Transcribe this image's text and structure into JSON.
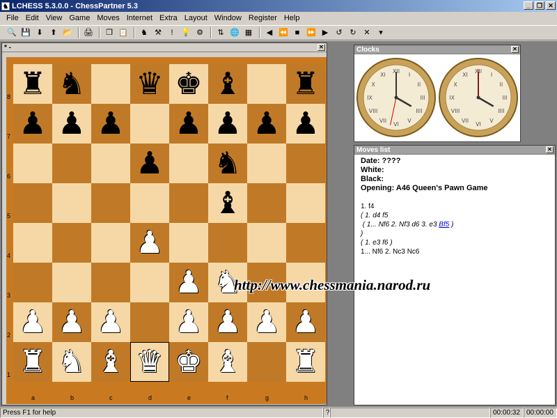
{
  "window": {
    "title": "LCHESS 5.3.0.0 - ChessPartner 5.3",
    "btn_min": "_",
    "btn_restore": "❐",
    "btn_close": "✕"
  },
  "menu": [
    "File",
    "Edit",
    "View",
    "Game",
    "Moves",
    "Internet",
    "Extra",
    "Layout",
    "Window",
    "Register",
    "Help"
  ],
  "toolbar": {
    "groups": [
      [
        {
          "icon": "search-icon",
          "glyph": "🔍"
        },
        {
          "icon": "save-icon",
          "glyph": "💾"
        },
        {
          "icon": "arrow-down-icon",
          "glyph": "⬇"
        },
        {
          "icon": "arrow-up-icon",
          "glyph": "⬆"
        },
        {
          "icon": "open-folder-icon",
          "glyph": "📂"
        }
      ],
      [
        {
          "icon": "print-icon",
          "glyph": "🖨"
        }
      ],
      [
        {
          "icon": "copy-icon",
          "glyph": "❐"
        },
        {
          "icon": "paste-icon",
          "glyph": "📋"
        }
      ],
      [
        {
          "icon": "board-setup-icon",
          "glyph": "♞"
        },
        {
          "icon": "analysis-icon",
          "glyph": "⚒"
        },
        {
          "icon": "exclaim-icon",
          "glyph": "!"
        },
        {
          "icon": "hint-icon",
          "glyph": "💡"
        },
        {
          "icon": "engine-icon",
          "glyph": "⚙"
        }
      ],
      [
        {
          "icon": "flip-board-icon",
          "glyph": "⇅"
        },
        {
          "icon": "globe-icon",
          "glyph": "🌐"
        },
        {
          "icon": "grid-icon",
          "glyph": "▦"
        }
      ],
      [
        {
          "icon": "first-move-icon",
          "glyph": "◀"
        },
        {
          "icon": "back-icon",
          "glyph": "⏪"
        },
        {
          "icon": "stop-icon",
          "glyph": "■"
        },
        {
          "icon": "forward-icon",
          "glyph": "⏩"
        },
        {
          "icon": "last-move-icon",
          "glyph": "▶"
        },
        {
          "icon": "undo-icon",
          "glyph": "↺"
        },
        {
          "icon": "redo-icon",
          "glyph": "↻"
        },
        {
          "icon": "delete-icon",
          "glyph": "✕"
        },
        {
          "icon": "dropdown-icon",
          "glyph": "▾"
        }
      ]
    ]
  },
  "board_window": {
    "title": "* -",
    "ranks": [
      "8",
      "7",
      "6",
      "5",
      "4",
      "3",
      "2",
      "1"
    ],
    "files": [
      "a",
      "b",
      "c",
      "d",
      "e",
      "f",
      "g",
      "h"
    ],
    "position": [
      [
        "bR",
        "bN",
        "",
        "bQ",
        "bK",
        "bB",
        "",
        "bR"
      ],
      [
        "bP",
        "bP",
        "bP",
        "",
        "bP",
        "bP",
        "bP",
        "bP"
      ],
      [
        "",
        "",
        "",
        "bP",
        "",
        "bN",
        "",
        ""
      ],
      [
        "",
        "",
        "",
        "",
        "",
        "bB",
        "",
        ""
      ],
      [
        "",
        "",
        "",
        "wP",
        "",
        "",
        "",
        ""
      ],
      [
        "",
        "",
        "",
        "",
        "wP",
        "wN",
        "",
        ""
      ],
      [
        "wP",
        "wP",
        "wP",
        "",
        "wP",
        "wP",
        "wP",
        "wP"
      ],
      [
        "wR",
        "wN",
        "wB",
        "wQ",
        "wK",
        "wB",
        "",
        "wR"
      ]
    ],
    "selected_square": "d1",
    "piece_glyphs": {
      "K": "♚",
      "Q": "♛",
      "R": "♜",
      "B": "♝",
      "N": "♞",
      "P": "♟"
    },
    "colors": {
      "light": "#f6d8a6",
      "dark": "#c07a27",
      "frame": "#c97a21"
    }
  },
  "clocks": {
    "title": "Clocks",
    "left": {
      "hour": 4,
      "minute": 0,
      "second": 32
    },
    "right": {
      "hour": 4,
      "minute": 0,
      "second": 0
    }
  },
  "moves_list": {
    "title": "Moves list",
    "date": "Date: ????",
    "white": "White:",
    "black": "Black:",
    "opening": "Opening: A46 Queen's Pawn Game",
    "line1": "1. f4",
    "line2": "( 1. d4 f5",
    "line3_pre": "( 1... Nf6 2. Nf3 d6 3. e3 ",
    "line3_link": "Bf5",
    "line3_post": " )",
    "line4": ")",
    "line5": "( 1. e3 f6 )",
    "line6": "1... Nf6 2. Nc3 Nc6"
  },
  "watermark": "http://www.chessmania.narod.ru",
  "status": {
    "help": "Press F1 for help",
    "q": "?",
    "time_white": "00:00:32",
    "time_black": "00:00:00"
  }
}
